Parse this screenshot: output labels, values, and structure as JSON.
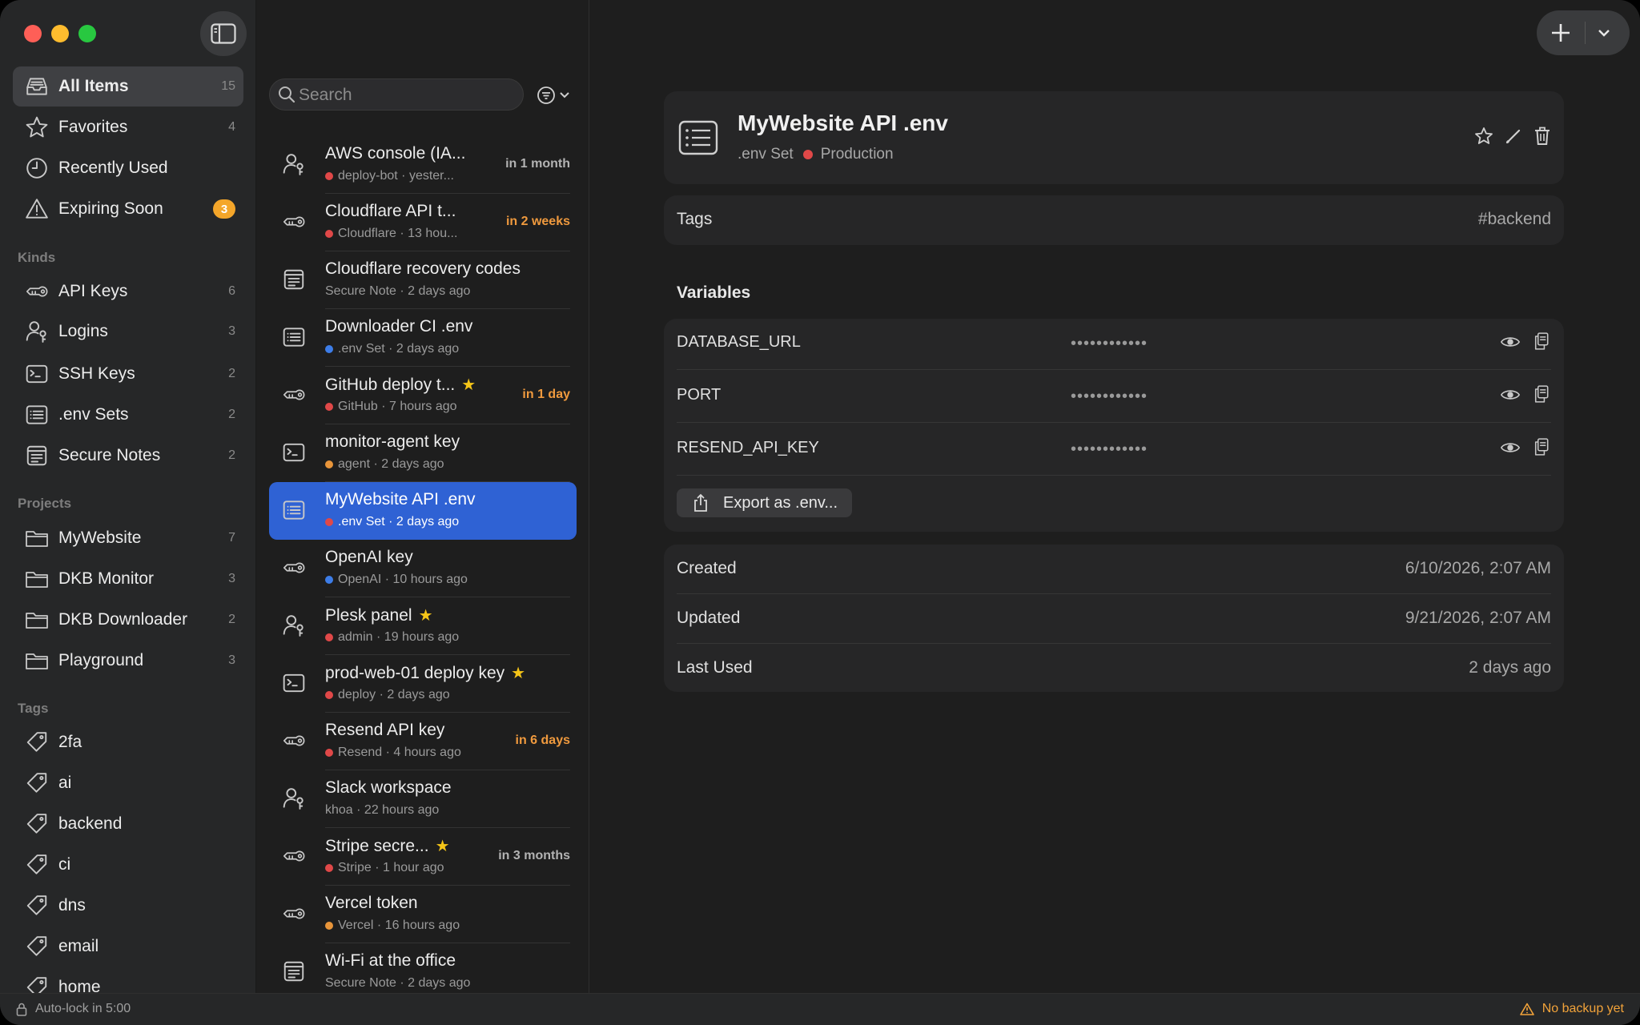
{
  "sidebar": {
    "main": [
      {
        "label": "All Items",
        "count": "15",
        "icon": "tray-icon"
      },
      {
        "label": "Favorites",
        "count": "4",
        "icon": "star-icon"
      },
      {
        "label": "Recently Used",
        "count": "",
        "icon": "clock-icon"
      },
      {
        "label": "Expiring Soon",
        "badge": "3",
        "icon": "warning-icon"
      }
    ],
    "kinds_heading": "Kinds",
    "kinds": [
      {
        "label": "API Keys",
        "count": "6",
        "icon": "key-icon"
      },
      {
        "label": "Logins",
        "count": "3",
        "icon": "person-key-icon"
      },
      {
        "label": "SSH Keys",
        "count": "2",
        "icon": "terminal-icon"
      },
      {
        "label": ".env Sets",
        "count": "2",
        "icon": "list-icon"
      },
      {
        "label": "Secure Notes",
        "count": "2",
        "icon": "note-icon"
      }
    ],
    "projects_heading": "Projects",
    "projects": [
      {
        "label": "MyWebsite",
        "count": "7"
      },
      {
        "label": "DKB Monitor",
        "count": "3"
      },
      {
        "label": "DKB Downloader",
        "count": "2"
      },
      {
        "label": "Playground",
        "count": "3"
      }
    ],
    "tags_heading": "Tags",
    "tags": [
      "2fa",
      "ai",
      "backend",
      "ci",
      "dns",
      "email",
      "home"
    ]
  },
  "search": {
    "placeholder": "Search"
  },
  "list": [
    {
      "title": "AWS console (IA...",
      "sub": "deploy-bot · yester...",
      "dot": "#e04848",
      "exp": "in 1 month",
      "warn": false,
      "star": false,
      "icon": "person-key-icon"
    },
    {
      "title": "Cloudflare API t...",
      "sub": "Cloudflare · 13 hou...",
      "dot": "#e04848",
      "exp": "in 2 weeks",
      "warn": true,
      "star": false,
      "icon": "key-icon"
    },
    {
      "title": "Cloudflare recovery codes",
      "sub": "Secure Note · 2 days ago",
      "dot": "",
      "exp": "",
      "warn": false,
      "star": false,
      "icon": "note-icon"
    },
    {
      "title": "Downloader CI .env",
      "sub": ".env Set · 2 days ago",
      "dot": "#3d7de8",
      "exp": "",
      "warn": false,
      "star": false,
      "icon": "list-icon"
    },
    {
      "title": "GitHub deploy t...",
      "sub": "GitHub · 7 hours ago",
      "dot": "#e04848",
      "exp": "in 1 day",
      "warn": true,
      "star": true,
      "icon": "key-icon"
    },
    {
      "title": "monitor-agent key",
      "sub": "agent · 2 days ago",
      "dot": "#e8953a",
      "exp": "",
      "warn": false,
      "star": false,
      "icon": "terminal-icon"
    },
    {
      "title": "MyWebsite API .env",
      "sub": ".env Set · 2 days ago",
      "dot": "#e04848",
      "exp": "",
      "warn": false,
      "star": false,
      "icon": "list-icon",
      "selected": true
    },
    {
      "title": "OpenAI key",
      "sub": "OpenAI · 10 hours ago",
      "dot": "#3d7de8",
      "exp": "",
      "warn": false,
      "star": false,
      "icon": "key-icon"
    },
    {
      "title": "Plesk panel",
      "sub": "admin · 19 hours ago",
      "dot": "#e04848",
      "exp": "",
      "warn": false,
      "star": true,
      "icon": "person-key-icon"
    },
    {
      "title": "prod-web-01 deploy key",
      "sub": "deploy · 2 days ago",
      "dot": "#e04848",
      "exp": "",
      "warn": false,
      "star": true,
      "icon": "terminal-icon"
    },
    {
      "title": "Resend API key",
      "sub": "Resend · 4 hours ago",
      "dot": "#e04848",
      "exp": "in 6 days",
      "warn": true,
      "star": false,
      "icon": "key-icon"
    },
    {
      "title": "Slack workspace",
      "sub": "khoa · 22 hours ago",
      "dot": "",
      "exp": "",
      "warn": false,
      "star": false,
      "icon": "person-key-icon"
    },
    {
      "title": "Stripe secre...",
      "sub": "Stripe · 1 hour ago",
      "dot": "#e04848",
      "exp": "in 3 months",
      "warn": false,
      "star": true,
      "icon": "key-icon"
    },
    {
      "title": "Vercel token",
      "sub": "Vercel · 16 hours ago",
      "dot": "#e8953a",
      "exp": "",
      "warn": false,
      "star": false,
      "icon": "key-icon"
    },
    {
      "title": "Wi-Fi at the office",
      "sub": "Secure Note · 2 days ago",
      "dot": "",
      "exp": "",
      "warn": false,
      "star": false,
      "icon": "note-icon"
    }
  ],
  "detail": {
    "title": "MyWebsite API .env",
    "kind": ".env Set",
    "project": "Production",
    "project_color": "#e04848",
    "tags_label": "Tags",
    "tags_value": "#backend",
    "variables_heading": "Variables",
    "variables": [
      {
        "key": "DATABASE_URL",
        "value": "••••••••••••"
      },
      {
        "key": "PORT",
        "value": "••••••••••••"
      },
      {
        "key": "RESEND_API_KEY",
        "value": "••••••••••••"
      }
    ],
    "export_label": "Export as .env...",
    "meta": [
      {
        "key": "Created",
        "value": "6/10/2026, 2:07 AM"
      },
      {
        "key": "Updated",
        "value": "9/21/2026, 2:07 AM"
      },
      {
        "key": "Last Used",
        "value": "2 days ago"
      }
    ]
  },
  "status": {
    "autolock": "Auto-lock in 5:00",
    "backup": "No backup yet"
  },
  "colors": {
    "accent": "#2f62d4",
    "warning": "#f09a3e",
    "star": "#f5c518"
  }
}
